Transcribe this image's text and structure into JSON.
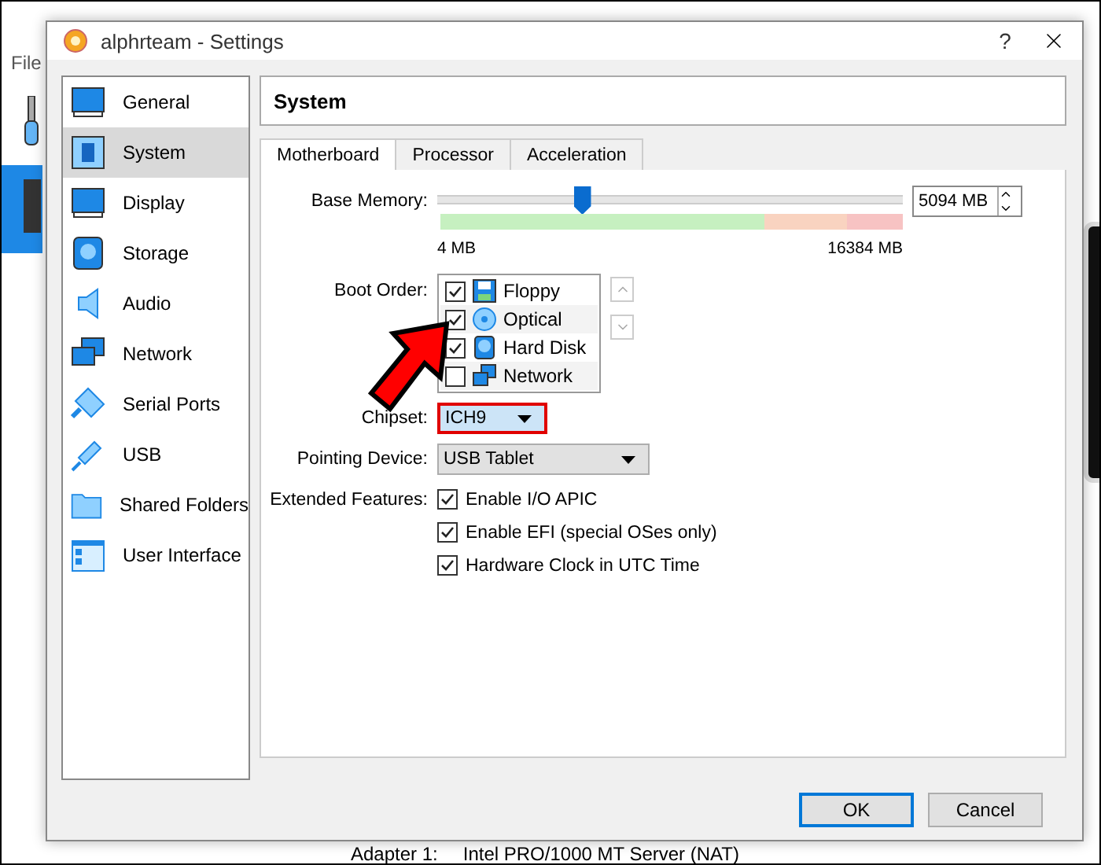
{
  "background_window": {
    "menu": [
      "File"
    ],
    "details": [
      {
        "label": "Adapter 1:",
        "value": "Intel PRO/1000 MT Server (NAT)"
      }
    ]
  },
  "dialog": {
    "title": "alphrteam - Settings",
    "help": "?"
  },
  "sidebar": [
    {
      "label": "General",
      "kind": "general",
      "selected": false
    },
    {
      "label": "System",
      "kind": "system",
      "selected": true
    },
    {
      "label": "Display",
      "kind": "display",
      "selected": false
    },
    {
      "label": "Storage",
      "kind": "storage",
      "selected": false
    },
    {
      "label": "Audio",
      "kind": "audio",
      "selected": false
    },
    {
      "label": "Network",
      "kind": "network",
      "selected": false
    },
    {
      "label": "Serial Ports",
      "kind": "serial",
      "selected": false
    },
    {
      "label": "USB",
      "kind": "usb",
      "selected": false
    },
    {
      "label": "Shared Folders",
      "kind": "folder",
      "selected": false
    },
    {
      "label": "User Interface",
      "kind": "ui",
      "selected": false
    }
  ],
  "section_title": "System",
  "tabs": [
    {
      "label": "Motherboard",
      "selected": true
    },
    {
      "label": "Processor",
      "selected": false
    },
    {
      "label": "Acceleration",
      "selected": false
    }
  ],
  "base_memory": {
    "label": "Base Memory:",
    "level": 0.31,
    "value": "5094 MB",
    "min": "4 MB",
    "max": "16384 MB"
  },
  "boot_order": {
    "label": "Boot Order:",
    "items": [
      {
        "name": "Floppy",
        "kind": "floppy",
        "checked": true
      },
      {
        "name": "Optical",
        "kind": "optical",
        "checked": true
      },
      {
        "name": "Hard Disk",
        "kind": "disk",
        "checked": true
      },
      {
        "name": "Network",
        "kind": "network",
        "checked": false
      }
    ]
  },
  "chipset": {
    "label": "Chipset:",
    "value": "ICH9",
    "highlighted": true
  },
  "pointing_device": {
    "label": "Pointing Device:",
    "value": "USB Tablet"
  },
  "extended_features": {
    "label": "Extended Features:",
    "options": [
      {
        "label": "Enable I/O APIC",
        "checked": true
      },
      {
        "label": "Enable EFI (special OSes only)",
        "checked": true
      },
      {
        "label": "Hardware Clock in UTC Time",
        "checked": true
      }
    ]
  },
  "buttons": [
    {
      "label": "OK",
      "default": true
    },
    {
      "label": "Cancel",
      "default": false
    }
  ]
}
